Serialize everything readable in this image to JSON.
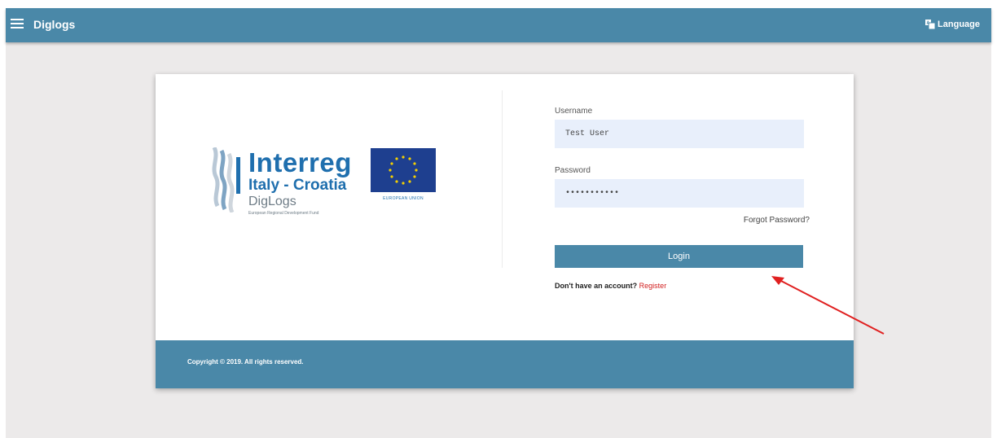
{
  "header": {
    "app_title": "Diglogs",
    "language_label": "Language",
    "accent_color": "#4a88a8"
  },
  "brand": {
    "title": "Interreg",
    "subtitle": "Italy - Croatia",
    "project": "DigLogs",
    "fund": "European Regional Development Fund",
    "eu_label": "EUROPEAN UNION"
  },
  "form": {
    "username_label": "Username",
    "username_value": "Test User",
    "password_label": "Password",
    "password_value": "•••••••••••",
    "forgot_label": "Forgot Password?",
    "login_label": "Login",
    "no_account_text": "Don't have an account?",
    "register_label": "Register"
  },
  "footer": {
    "copyright": "Copyright © 2019. All rights reserved."
  },
  "icons": [
    "menu-icon",
    "language-icon",
    "eu-flag-icon",
    "interreg-waves-icon",
    "annotation-arrow"
  ]
}
